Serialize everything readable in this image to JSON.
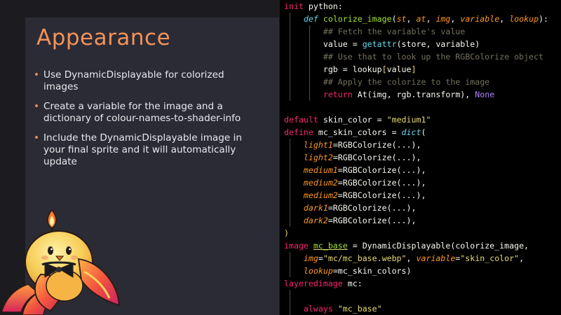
{
  "slide": {
    "title": "Appearance",
    "bullets": [
      "Use DynamicDisplayable for colorized images",
      "Create a variable for the image and a dictionary of colour-names-to-shader-info",
      "Include the DynamicDisplayable image in your final sprite and it will automatically update"
    ]
  },
  "colors": {
    "accent": "#f2935a",
    "slide_bg": "#2b2b35",
    "editor_bg": "#000000"
  },
  "code": {
    "l1": {
      "kw": "init",
      "rest": " python:"
    },
    "l2": {
      "def": "def",
      "name": "colorize_image",
      "open": "(",
      "p1": "st",
      "c1": ", ",
      "p2": "at",
      "c2": ", ",
      "p3": "img",
      "c3": ", ",
      "p4": "variable",
      "c4": ", ",
      "p5": "lookup",
      "close": "):"
    },
    "l3": "## Fetch the variable's value",
    "l4": {
      "a": "value = ",
      "fn": "getattr",
      "b": "(store, variable)"
    },
    "l5": "## Use that to look up the RGBColorize object",
    "l6": {
      "a": "rgb = lookup",
      "ob": "[",
      "v": "value",
      "cb": "]"
    },
    "l7": "## Apply the colorize to the image",
    "l8": {
      "kw": "return",
      "a": " At(img, rgb.transform), ",
      "none": "None"
    },
    "l10": {
      "kw": "default",
      "a": " skin_color = ",
      "str": "\"medium1\""
    },
    "l11": {
      "kw": "define",
      "a": " mc_skin_colors = ",
      "bi": "dict",
      "b": "("
    },
    "entries": [
      {
        "key": "light1",
        "val": "=RGBColorize(...),"
      },
      {
        "key": "light2",
        "val": "=RGBColorize(...),"
      },
      {
        "key": "medium1",
        "val": "=RGBColorize(...),"
      },
      {
        "key": "medium2",
        "val": "=RGBColorize(...),"
      },
      {
        "key": "medium2",
        "val": "=RGBColorize(...),"
      },
      {
        "key": "dark1",
        "val": "=RGBColorize(...),"
      },
      {
        "key": "dark2",
        "val": "=RGBColorize(...),"
      }
    ],
    "l19": ")",
    "l20": {
      "kw": "image",
      "sp": " ",
      "name": "mc_base",
      "a": " = DynamicDisplayable(colorize_image,"
    },
    "l21": {
      "k1": "img",
      "eq1": "=",
      "s1": "\"mc/mc_base.webp\"",
      "c": ", ",
      "k2": "variable",
      "eq2": "=",
      "s2": "\"skin_color\"",
      "e": ","
    },
    "l22": {
      "k": "lookup",
      "v": "=mc_skin_colors)"
    },
    "l23": {
      "kw": "layeredimage",
      "a": " mc:"
    },
    "l25": {
      "kw": "always",
      "sp": " ",
      "str": "\"mc_base\""
    }
  }
}
